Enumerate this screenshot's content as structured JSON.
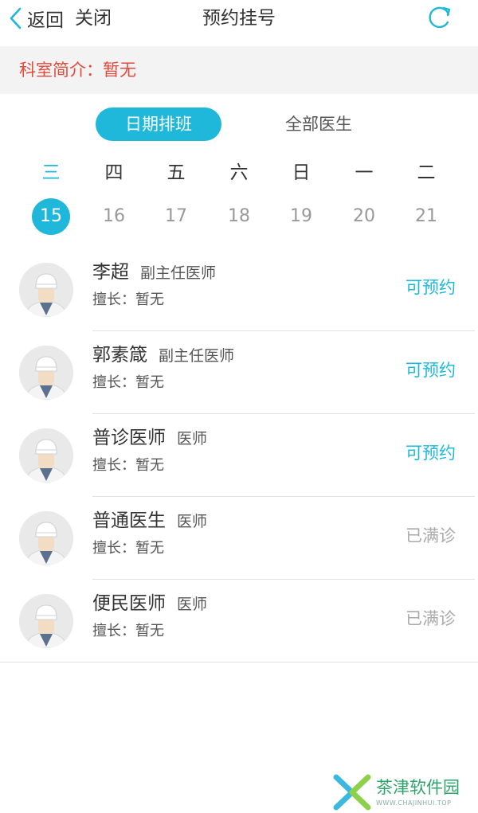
{
  "header": {
    "back_label": "返回",
    "close_label": "关闭",
    "title": "预约挂号"
  },
  "department": {
    "intro": "科室简介：暂无"
  },
  "tabs": [
    {
      "label": "日期排班",
      "active": true
    },
    {
      "label": "全部医生",
      "active": false
    }
  ],
  "week": {
    "days": [
      {
        "weekday": "三",
        "date": "15",
        "selected": true
      },
      {
        "weekday": "四",
        "date": "16",
        "selected": false
      },
      {
        "weekday": "五",
        "date": "17",
        "selected": false
      },
      {
        "weekday": "六",
        "date": "18",
        "selected": false
      },
      {
        "weekday": "日",
        "date": "19",
        "selected": false
      },
      {
        "weekday": "一",
        "date": "20",
        "selected": false
      },
      {
        "weekday": "二",
        "date": "21",
        "selected": false
      }
    ]
  },
  "doctors": [
    {
      "name": "李超",
      "title": "副主任医师",
      "skill": "擅长：暂无",
      "status": "可预约",
      "available": true
    },
    {
      "name": "郭素箴",
      "title": "副主任医师",
      "skill": "擅长：暂无",
      "status": "可预约",
      "available": true
    },
    {
      "name": "普诊医师",
      "title": "医师",
      "skill": "擅长：暂无",
      "status": "可预约",
      "available": true
    },
    {
      "name": "普通医生",
      "title": "医师",
      "skill": "擅长：暂无",
      "status": "已满诊",
      "available": false
    },
    {
      "name": "便民医师",
      "title": "医师",
      "skill": "擅长：暂无",
      "status": "已满诊",
      "available": false
    }
  ],
  "watermark": {
    "name": "茶津软件园",
    "url": "WWW.CHAJINHUI.TOP"
  },
  "colors": {
    "accent": "#1fb8db",
    "intro_red": "#e24a3c",
    "full_gray": "#aaaaaa"
  },
  "icons": [
    "chevron-left-icon",
    "refresh-icon",
    "doctor-avatar-icon"
  ]
}
